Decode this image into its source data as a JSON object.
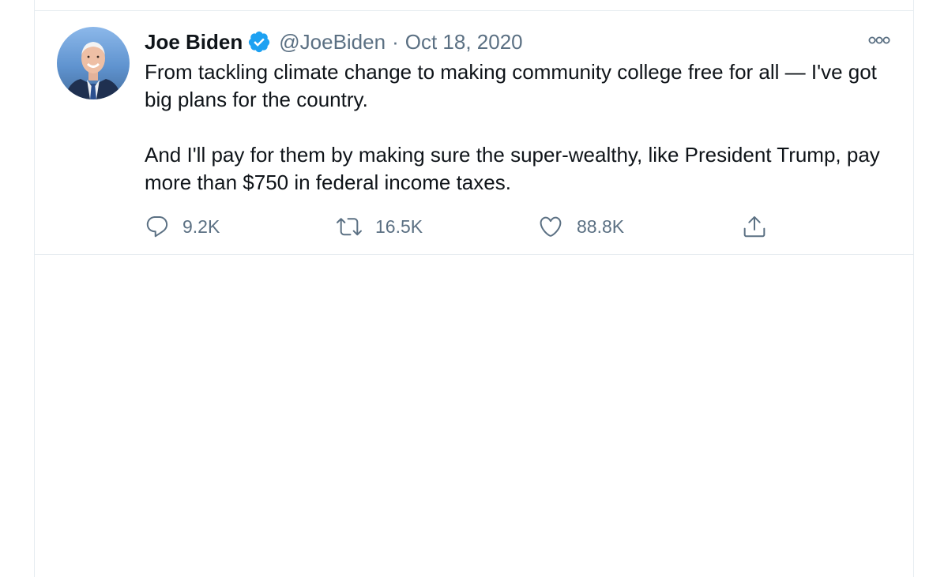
{
  "tweet": {
    "author_name": "Joe Biden",
    "handle": "@JoeBiden",
    "separator": "·",
    "date": "Oct 18, 2020",
    "text_paragraphs": [
      "From tackling climate change to making community college free for all — I've got big plans for the country.",
      "And I'll pay for them by making sure the super-wealthy, like President Trump, pay more than $750 in federal income taxes."
    ],
    "actions": {
      "reply_count": "9.2K",
      "retweet_count": "16.5K",
      "like_count": "88.8K"
    }
  },
  "colors": {
    "verified_blue": "#1da1f2",
    "secondary_text": "#5b7083",
    "border": "#e6ecf0"
  },
  "icons": {
    "verified": "verified-badge-icon",
    "more": "more-options-icon",
    "reply": "reply-icon",
    "retweet": "retweet-icon",
    "like": "heart-icon",
    "share": "share-icon"
  }
}
